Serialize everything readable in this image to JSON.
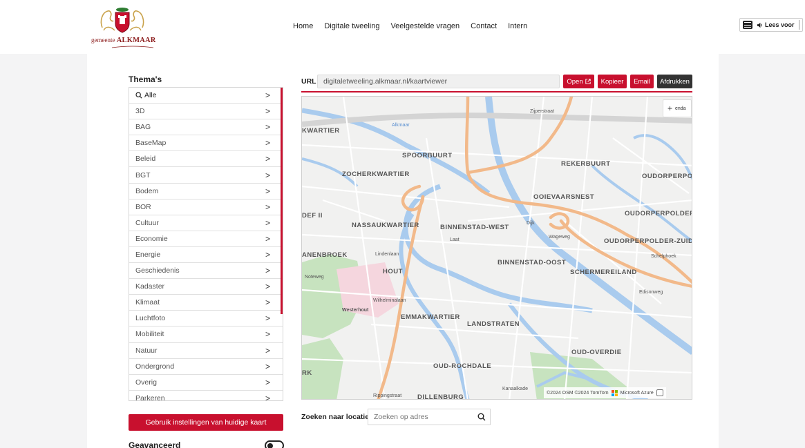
{
  "header": {
    "logo": {
      "prefix": "gemeente",
      "name": "ALKMAAR"
    },
    "nav": [
      "Home",
      "Digitale tweeling",
      "Veelgestelde vragen",
      "Contact",
      "Intern"
    ],
    "tools": {
      "read_label": "Lees voor"
    }
  },
  "sidebar": {
    "title": "Thema's",
    "items": [
      "Alle",
      "3D",
      "BAG",
      "BaseMap",
      "Beleid",
      "BGT",
      "Bodem",
      "BOR",
      "Cultuur",
      "Economie",
      "Energie",
      "Geschiedenis",
      "Kadaster",
      "Klimaat",
      "Luchtfoto",
      "Mobiliteit",
      "Natuur",
      "Ondergrond",
      "Overig",
      "Parkeren"
    ],
    "apply_button": "Gebruik instellingen van huidige kaart",
    "advanced_label": "Geavanceerd"
  },
  "url_bar": {
    "label": "URL",
    "value": "digitaletweeling.alkmaar.nl/kaartviewer",
    "buttons": {
      "open": "Open",
      "copy": "Kopieer",
      "email": "Email",
      "print": "Afdrukken"
    }
  },
  "map": {
    "zoom_label": "enda",
    "areas": [
      "KWARTIER",
      "SPOORBUURT",
      "ZOCHERKWARTIER",
      "REKERBUURT",
      "OUDORPERPO",
      "OOIEVAARSNEST",
      "OUDORPERPOLDER",
      "DEF II",
      "NASSAUKWARTIER",
      "BINNENSTAD-WEST",
      "OUDORPERPOLDER-ZUID",
      "ANENBROEK",
      "BINNENSTAD-OOST",
      "HOUT",
      "SCHERMEREILAND",
      "EMMAKWARTIER",
      "LANDSTRATEN",
      "OUD-OVERDIE",
      "OUD-ROCHDALE",
      "DILLENBURG",
      "RK"
    ],
    "streets": [
      "Zijperstraat",
      "Alkmaar",
      "Lindenlaan",
      "Westerhout",
      "Wilhelminalaan",
      "Laat",
      "Dijk",
      "Wageweg",
      "Edisonweg",
      "Schelphoek",
      "Noteweg",
      "Rippingstraat",
      "Kanaalkade"
    ],
    "attribution": "©2024 OSM ©2024 TomTom",
    "azure": "Microsoft Azure"
  },
  "search": {
    "label": "Zoeken naar locatie:",
    "placeholder": "Zoeken op adres"
  }
}
